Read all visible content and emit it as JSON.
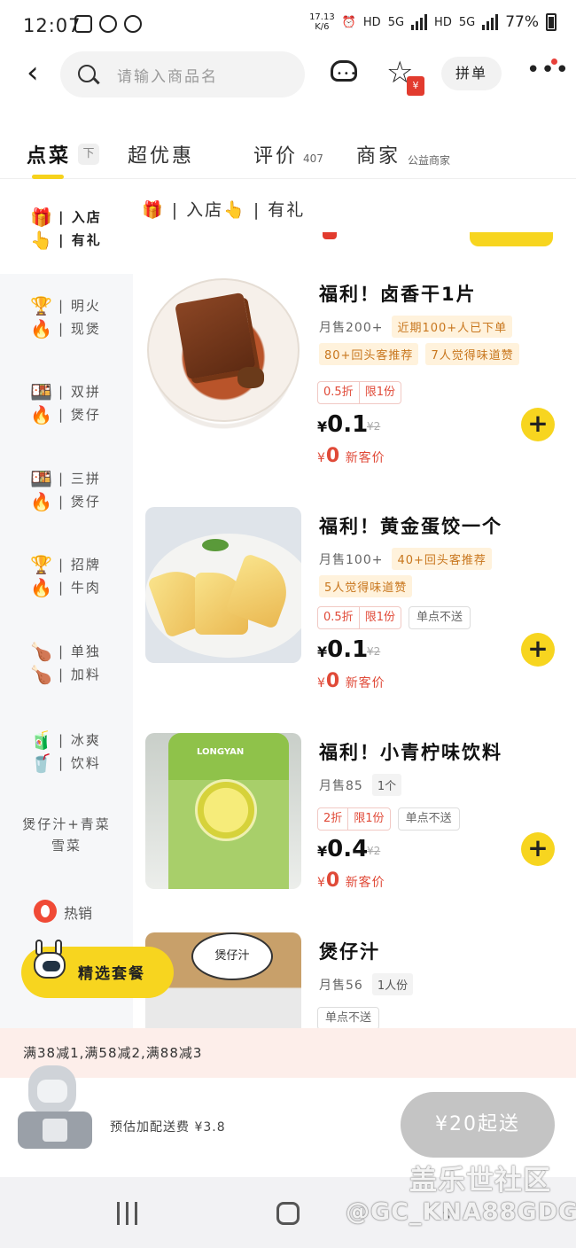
{
  "status_bar": {
    "time": "12:07",
    "date_top": "17.13",
    "date_bottom": "K/6",
    "hd1": "HD",
    "net1": "5G",
    "hd2": "HD",
    "net2": "5G",
    "battery": "77%"
  },
  "header": {
    "search_placeholder": "请输入商品名",
    "group_order_label": "拼单",
    "fav_badge": "¥",
    "more_icon": "more-dots-icon"
  },
  "tabs": [
    {
      "label": "点菜",
      "sub": "",
      "active": true
    },
    {
      "label": "超优惠",
      "sub": ""
    },
    {
      "label": "评价",
      "sub": "407"
    },
    {
      "label": "商家",
      "sub": "公益商家"
    }
  ],
  "tab_fold_label": "下",
  "sidebar": {
    "items": [
      {
        "emoji_top": "🎁",
        "emoji_bottom": "👆",
        "line1": "| 入店",
        "line2": "| 有礼"
      },
      {
        "emoji_top": "🏆",
        "emoji_bottom": "🔥",
        "line1": "| 明火",
        "line2": "| 现煲"
      },
      {
        "emoji_top": "🍱",
        "emoji_bottom": "🔥",
        "line1": "| 双拼",
        "line2": "| 煲仔"
      },
      {
        "emoji_top": "🍱",
        "emoji_bottom": "🔥",
        "line1": "| 三拼",
        "line2": "| 煲仔"
      },
      {
        "emoji_top": "🏆",
        "emoji_bottom": "🔥",
        "line1": "| 招牌",
        "line2": "| 牛肉"
      },
      {
        "emoji_top": "🍗",
        "emoji_bottom": "🍗",
        "line1": "| 单独",
        "line2": "| 加料"
      },
      {
        "emoji_top": "🧃",
        "emoji_bottom": "🥤",
        "line1": "| 冰爽",
        "line2": "| 饮料"
      }
    ],
    "text_item": "煲仔汁+青菜雪菜",
    "hot_label": "热销"
  },
  "list_banner": "🎁 | 入店👆 | 有礼",
  "products": [
    {
      "name": "福利！卤香干1片",
      "sales": "月售200+",
      "tags": [
        "近期100+人已下单",
        "80+回头客推荐",
        "7人觉得味道赞"
      ],
      "discount": "0.5折",
      "limit": "限1份",
      "extra": "",
      "price_symbol": "¥",
      "price": "0.1",
      "orig_price": "¥2",
      "new_price_symbol": "¥",
      "new_price": "0",
      "new_label": "新客价"
    },
    {
      "name": "福利！黄金蛋饺一个",
      "sales": "月售100+",
      "tags": [
        "40+回头客推荐",
        "5人觉得味道赞"
      ],
      "discount": "0.5折",
      "limit": "限1份",
      "extra": "单点不送",
      "price_symbol": "¥",
      "price": "0.1",
      "orig_price": "¥2",
      "new_price_symbol": "¥",
      "new_price": "0",
      "new_label": "新客价"
    },
    {
      "name": "福利！小青柠味饮料",
      "sales": "月售85",
      "tags": [
        "1个"
      ],
      "discount": "2折",
      "limit": "限1份",
      "extra": "单点不送",
      "price_symbol": "¥",
      "price": "0.4",
      "orig_price": "¥2",
      "new_price_symbol": "¥",
      "new_price": "0",
      "new_label": "新客价",
      "brand": "LONGYAN"
    },
    {
      "name": "煲仔汁",
      "sales": "月售56",
      "tags": [
        "1人份"
      ],
      "extra": "单点不送",
      "bubble": "煲仔汁"
    }
  ],
  "combo_button": "精选套餐",
  "discount_strip": "满38减1,满58减2,满88减3",
  "cart": {
    "fee": "预估加配送费 ¥3.8",
    "checkout": "¥20起送"
  },
  "watermark": {
    "line1": "盖乐世社区",
    "line2": "@GC_KNA88GDG"
  }
}
